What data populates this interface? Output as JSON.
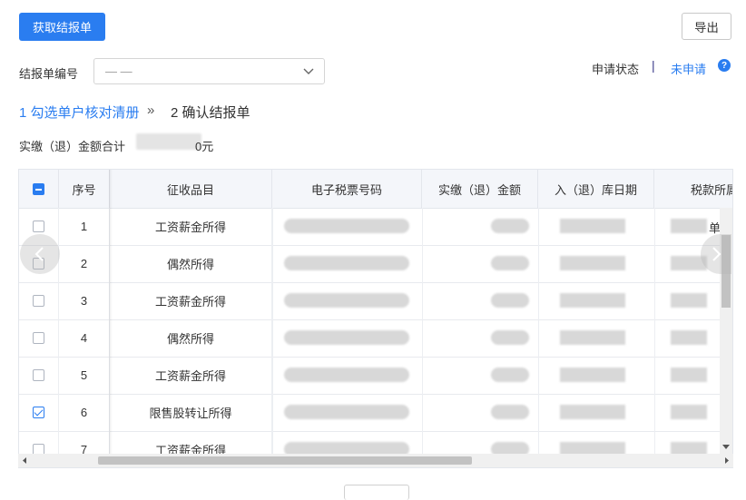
{
  "toolbar": {
    "fetch_label": "获取结报单",
    "export_label": "导出"
  },
  "filter": {
    "label": "结报单编号",
    "select_value": "— —"
  },
  "status": {
    "label": "申请状态",
    "separator": "|",
    "value": "未申请",
    "help": "?"
  },
  "steps": {
    "step1": "1 勾选单户核对清册",
    "arrow": "»",
    "step2": "2 确认结报单"
  },
  "total": {
    "label": "实缴（退）金额合计",
    "suffix": "0元"
  },
  "table": {
    "headers": [
      "序号",
      "征收品目",
      "电子税票号码",
      "实缴（退）金额",
      "入（退）库日期",
      "税款所属"
    ],
    "rows": [
      {
        "no": "1",
        "item": "工资薪金所得",
        "checked": false,
        "tail": "单"
      },
      {
        "no": "2",
        "item": "偶然所得",
        "checked": false,
        "tail": ""
      },
      {
        "no": "3",
        "item": "工资薪金所得",
        "checked": false,
        "tail": ""
      },
      {
        "no": "4",
        "item": "偶然所得",
        "checked": false,
        "tail": ""
      },
      {
        "no": "5",
        "item": "工资薪金所得",
        "checked": false,
        "tail": ""
      },
      {
        "no": "6",
        "item": "限售股转让所得",
        "checked": true,
        "tail": ""
      },
      {
        "no": "7",
        "item": "工资薪金所得",
        "checked": false,
        "tail": ""
      }
    ]
  },
  "colors": {
    "primary": "#2a7df0",
    "header_bg": "#f4f6fa"
  }
}
